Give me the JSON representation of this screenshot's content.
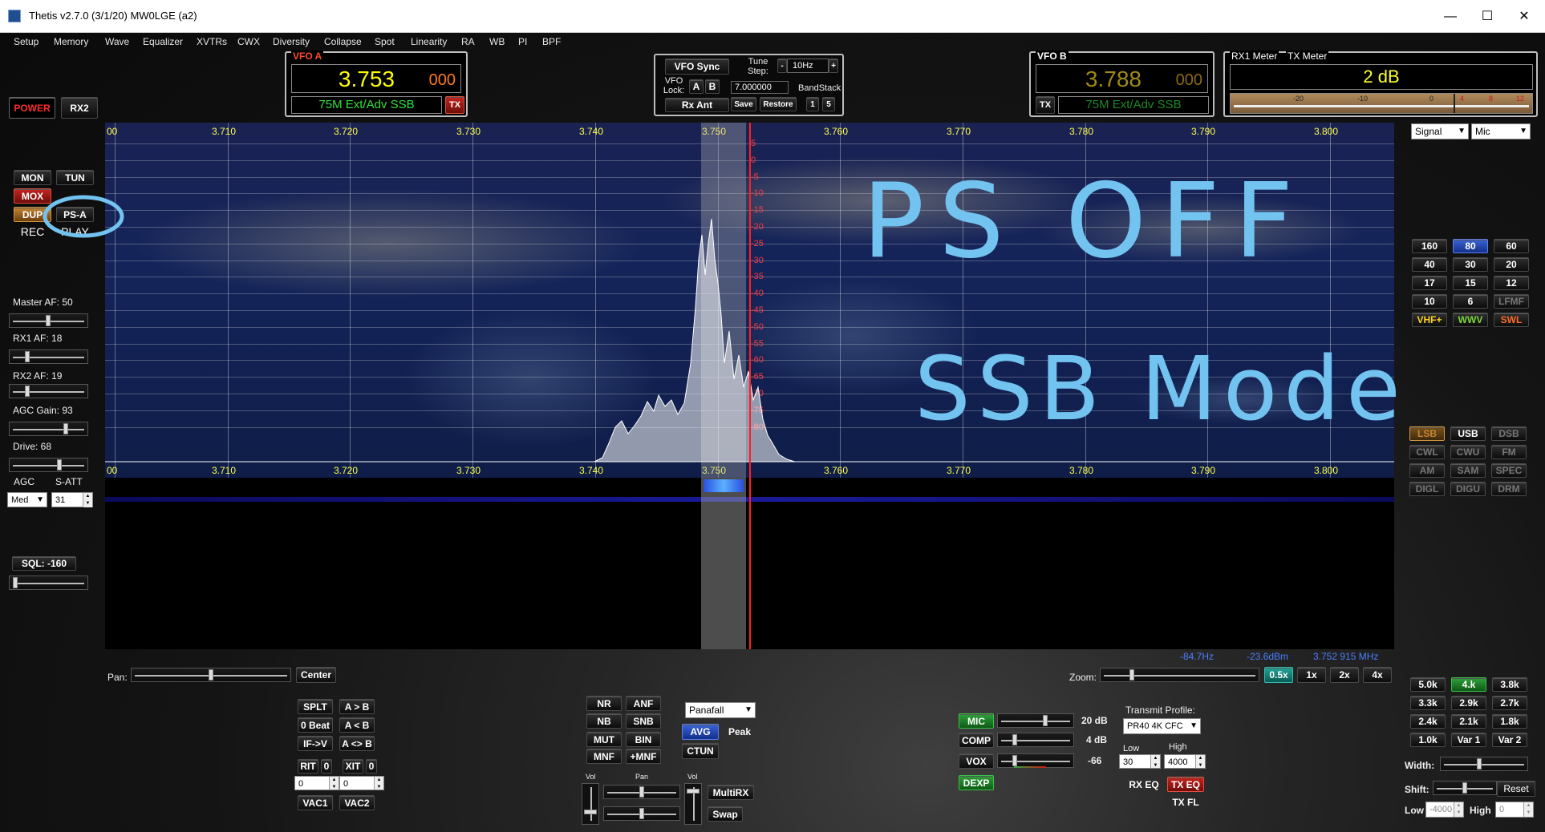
{
  "window": {
    "title": "Thetis v2.7.0 (3/1/20) MW0LGE (a2)",
    "minimize": "—",
    "maximize": "☐",
    "close": "✕"
  },
  "menu": [
    "Setup",
    "Memory",
    "Wave",
    "Equalizer",
    "XVTRs",
    "CWX",
    "Diversity",
    "Collapse",
    "Spot",
    "Linearity",
    "RA",
    "WB",
    "PI",
    "BPF"
  ],
  "power": {
    "power": "POWER",
    "rx2": "RX2"
  },
  "vfo_a": {
    "label": "VFO A",
    "freq_main": "3.753",
    "freq_sub": "000",
    "band": "75M Ext/Adv SSB",
    "tx": "TX"
  },
  "vfo_sync": {
    "sync": "VFO Sync",
    "tune_step_label": "Tune Step:",
    "tune_step": "10Hz",
    "minus": "-",
    "plus": "+",
    "lock_label": "VFO Lock:",
    "a": "A",
    "b": "B",
    "lock_freq": "7.000000",
    "bandstack": "BandStack",
    "rx_ant": "Rx Ant",
    "save": "Save",
    "restore": "Restore",
    "n1": "1",
    "n5": "5"
  },
  "vfo_b": {
    "label": "VFO B",
    "freq_main": "3.788",
    "freq_sub": "000",
    "band": "75M Ext/Adv SSB",
    "tx": "TX"
  },
  "meter": {
    "rx_label": "RX1 Meter",
    "tx_label": "TX Meter",
    "value": "2 dB",
    "scale": [
      "-20",
      "-10",
      "0",
      "4",
      "8",
      "12"
    ],
    "signal": "Signal",
    "mic": "Mic"
  },
  "left": {
    "mon": "MON",
    "tun": "TUN",
    "mox": "MOX",
    "dup": "DUP",
    "psa": "PS-A",
    "rec": "REC",
    "play": "PLAY",
    "master_af": "Master AF:  50",
    "rx1_af": "RX1 AF:  18",
    "rx2_af": "RX2 AF:  19",
    "agc_gain": "AGC Gain:  93",
    "drive": "Drive:  68",
    "agc": "AGC",
    "satt": "S-ATT",
    "agc_mode": "Med",
    "satt_val": "31",
    "sql": "SQL:  -160",
    "levels": {
      "master_af": 0.5,
      "rx1_af": 0.18,
      "rx2_af": 0.19,
      "agc_gain": 0.78,
      "drive": 0.68,
      "sql": 0.0
    }
  },
  "spectrum": {
    "freq_labels": [
      "00",
      "3.710",
      "3.720",
      "3.730",
      "3.740",
      "3.750",
      "3.760",
      "3.770",
      "3.780",
      "3.790",
      "3.800"
    ],
    "db_labels": [
      "5",
      "0",
      "-5",
      "-10",
      "-15",
      "-20",
      "-25",
      "-30",
      "-35",
      "-40",
      "-45",
      "-50",
      "-55",
      "-60",
      "-65",
      "-70",
      "-75",
      "-80"
    ],
    "readout_offset": "-84.7Hz",
    "readout_dbm": "-23.6dBm",
    "readout_freq": "3.752 915 MHz"
  },
  "annotation": {
    "line1": "PS OFF",
    "line2": "SSB Mode"
  },
  "bands": [
    "160",
    "80",
    "60",
    "40",
    "30",
    "20",
    "17",
    "15",
    "12",
    "10",
    "6",
    "LFMF",
    "VHF+",
    "WWV",
    "SWL"
  ],
  "modes": [
    "LSB",
    "USB",
    "DSB",
    "CWL",
    "CWU",
    "FM",
    "AM",
    "SAM",
    "SPEC",
    "DIGL",
    "DIGU",
    "DRM"
  ],
  "filters": [
    "5.0k",
    "4.k",
    "3.8k",
    "3.3k",
    "2.9k",
    "2.7k",
    "2.4k",
    "2.1k",
    "1.8k",
    "1.0k",
    "Var 1",
    "Var 2"
  ],
  "filter_ctrl": {
    "width": "Width:",
    "shift": "Shift:",
    "reset": "Reset",
    "low": "Low",
    "low_val": "-4000",
    "high": "High",
    "high_val": "0"
  },
  "pan": {
    "label": "Pan:",
    "center": "Center",
    "zoom": "Zoom:",
    "z05": "0.5x",
    "z1": "1x",
    "z2": "2x",
    "z4": "4x"
  },
  "vfo_ops": {
    "splt": "SPLT",
    "atob": "A > B",
    "zbeat": "0 Beat",
    "actb": "A < B",
    "ifv": "IF->V",
    "swap": "A <> B",
    "rit": "RIT",
    "rit_n": "0",
    "xit": "XIT",
    "xit_n": "0",
    "rit_val": "0",
    "xit_val": "0",
    "vac1": "VAC1",
    "vac2": "VAC2"
  },
  "dsp": {
    "nr": "NR",
    "anf": "ANF",
    "nb": "NB",
    "snb": "SNB",
    "mut": "MUT",
    "bin": "BIN",
    "mnf": "MNF",
    "pmnf": "+MNF",
    "vol1": "Vol",
    "pan": "Pan",
    "vol2": "Vol",
    "multirx": "MultiRX",
    "swap": "Swap"
  },
  "display": {
    "mode": "Panafall",
    "avg": "AVG",
    "peak": "Peak",
    "ctun": "CTUN"
  },
  "tx": {
    "mic": "MIC",
    "mic_val": "20 dB",
    "comp": "COMP",
    "comp_val": "4 dB",
    "vox": "VOX",
    "vox_val": "-66",
    "dexp": "DEXP",
    "profile_label": "Transmit Profile:",
    "profile": "PR40 4K CFC",
    "low_label": "Low",
    "low_val": "30",
    "high_label": "High",
    "high_val": "4000",
    "rx_eq": "RX EQ",
    "tx_eq": "TX EQ",
    "tx_fl": "TX FL"
  }
}
